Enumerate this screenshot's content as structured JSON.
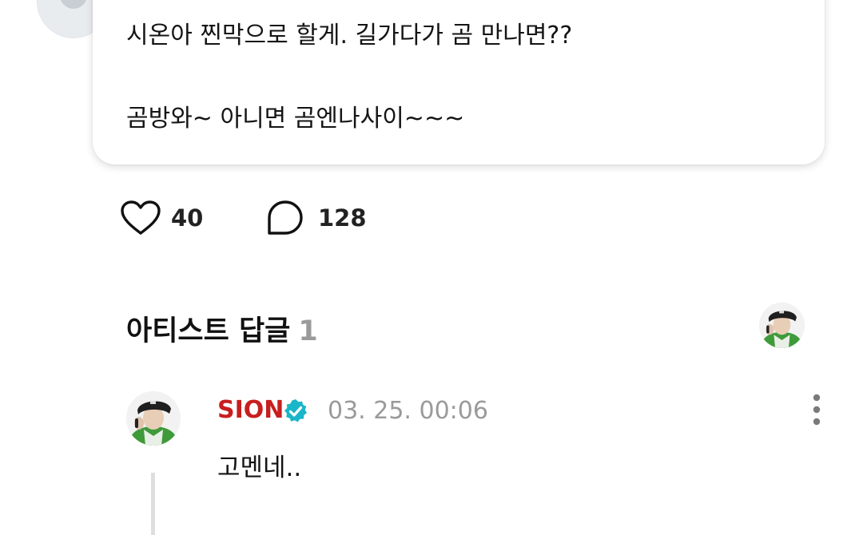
{
  "post": {
    "line1": "시온아 찐막으로 할게. 길가다가 곰 만나면??",
    "line2": "곰방와~ 아니면 곰엔나사이~~~"
  },
  "actions": {
    "like_count": "40",
    "comment_count": "128"
  },
  "artist_replies": {
    "title": "아티스트 답글",
    "count": "1"
  },
  "reply": {
    "author": "SION",
    "timestamp": "03. 25. 00:06",
    "text": "고멘네.."
  },
  "colors": {
    "author_name": "#c81e1e",
    "verified_badge": "#19b6c8",
    "muted": "#9a9a9a"
  }
}
